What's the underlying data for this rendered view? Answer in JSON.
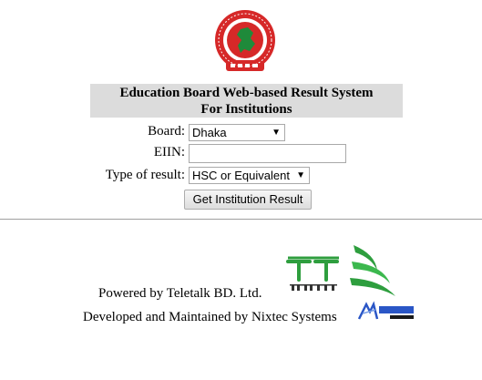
{
  "header": {
    "title_line1": "Education Board Web-based Result System",
    "title_line2": "For Institutions"
  },
  "form": {
    "board_label": "Board:",
    "board_value": "Dhaka",
    "eiin_label": "EIIN:",
    "eiin_value": "",
    "result_type_label": "Type of result:",
    "result_type_value": "HSC or Equivalent",
    "submit_label": "Get Institution Result"
  },
  "footer": {
    "powered_by": "Powered by Teletalk BD. Ltd.",
    "developed_by": "Developed and Maintained by Nixtec Systems"
  },
  "colors": {
    "title_bg": "#dcdcdc",
    "emblem_red": "#d62828",
    "emblem_green": "#1f8a3a",
    "teletalk_green": "#2e9e3e"
  }
}
